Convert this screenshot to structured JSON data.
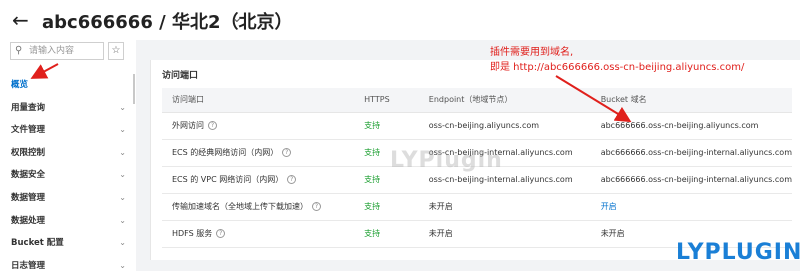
{
  "header": {
    "back_symbol": "←",
    "title": "abc666666 / 华北2（北京）",
    "chevron": "⌄"
  },
  "sidebar": {
    "search": {
      "placeholder": "请输入内容",
      "icon": "search-icon"
    },
    "star_symbol": "☆",
    "items": [
      {
        "label": "概览",
        "active": true,
        "chevron": ""
      },
      {
        "label": "用量查询",
        "active": false,
        "chevron": "⌄"
      },
      {
        "label": "文件管理",
        "active": false,
        "chevron": "⌄"
      },
      {
        "label": "权限控制",
        "active": false,
        "chevron": "⌄"
      },
      {
        "label": "数据安全",
        "active": false,
        "chevron": "⌄"
      },
      {
        "label": "数据管理",
        "active": false,
        "chevron": "⌄"
      },
      {
        "label": "数据处理",
        "active": false,
        "chevron": "⌄"
      },
      {
        "label": "Bucket 配置",
        "active": false,
        "chevron": "⌄"
      },
      {
        "label": "日志管理",
        "active": false,
        "chevron": "⌄"
      }
    ]
  },
  "main": {
    "section_title": "访问端口",
    "table": {
      "headers": [
        "访问端口",
        "HTTPS",
        "Endpoint（地域节点）",
        "Bucket 域名"
      ],
      "rows": [
        {
          "port": "外网访问",
          "help": "?",
          "https": "支持",
          "endpoint": "oss-cn-beijing.aliyuncs.com",
          "domain": "abc666666.oss-cn-beijing.aliyuncs.com"
        },
        {
          "port": "ECS 的经典网络访问（内网）",
          "help": "?",
          "https": "支持",
          "endpoint": "oss-cn-beijing-internal.aliyuncs.com",
          "domain": "abc666666.oss-cn-beijing-internal.aliyuncs.com"
        },
        {
          "port": "ECS 的 VPC 网络访问（内网）",
          "help": "?",
          "https": "支持",
          "endpoint": "oss-cn-beijing-internal.aliyuncs.com",
          "domain": "abc666666.oss-cn-beijing-internal.aliyuncs.com"
        },
        {
          "port": "传输加速域名（全地域上传下载加速）",
          "help": "?",
          "https": "支持",
          "endpoint": "未开启",
          "domain": "开启"
        },
        {
          "port": "HDFS 服务",
          "help": "?",
          "https": "支持",
          "endpoint": "未开启",
          "domain": "未开启"
        }
      ]
    }
  },
  "annotation": {
    "line1": "插件需要用到域名,",
    "line2": "即是 http://abc666666.oss-cn-beijing.aliyuncs.com/"
  },
  "watermarks": {
    "faint": "LYPlugin",
    "brand": "LYPLUGIN"
  },
  "colors": {
    "accent_blue": "#0070cc",
    "support_green": "#1a9e2f",
    "annotation_red": "#e0201c"
  }
}
